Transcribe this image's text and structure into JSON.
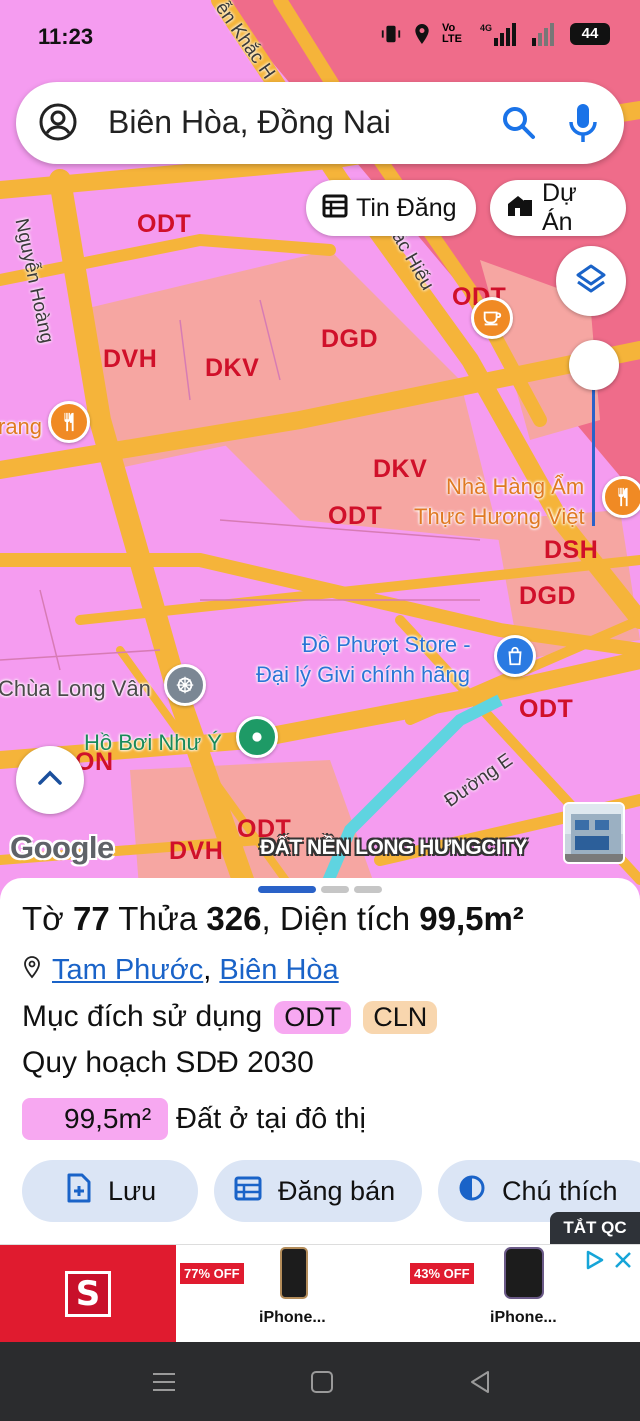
{
  "status_bar": {
    "time": "11:23",
    "battery": "44",
    "volte": "Vo LTE",
    "network": "4G"
  },
  "search": {
    "query": "Biên Hòa, Đồng Nai"
  },
  "chips": [
    {
      "label": "Tin Đăng",
      "icon": "calendar-icon"
    },
    {
      "label": "Dự Án",
      "icon": "building-icon"
    }
  ],
  "map": {
    "zones": [
      "ODT",
      "DVH",
      "DKV",
      "DGD",
      "ODT",
      "DKV",
      "ODT",
      "DSH",
      "DGD",
      "ODT",
      "ON",
      "DVH",
      "ODT"
    ],
    "streets": [
      "Nguyễn Hoàng",
      "ễn Khắc H",
      "ắc Hiếu",
      "Đường E",
      "rang"
    ],
    "pois": [
      {
        "label": "Nhà Hàng Ẩm\nThực Hương Việt",
        "line1": "Nhà Hàng Ẩm",
        "line2": "Thực Hương Việt",
        "icon": "restaurant-icon"
      },
      {
        "line1": "Đồ Phượt Store -",
        "line2": "Đại lý Givi chính hãng",
        "icon": "shopping-bag-icon"
      },
      {
        "label": "Chùa Long Vân",
        "icon": "temple-icon"
      },
      {
        "label": "Hồ Bơi Như Ý",
        "icon": "place-icon"
      }
    ],
    "google_logo": "Google",
    "banner": "ĐẤT NỀN LONG HƯNGCITY",
    "colors": {
      "residential": "#f59cf0",
      "public": "#f5a3a3",
      "road": "#f5b43a",
      "background": "#ef6c8a"
    }
  },
  "parcel": {
    "to_label": "Tờ",
    "to_value": "77",
    "thua_label": "Thửa",
    "thua_value": "326",
    "area_label": "Diện tích",
    "area_value": "99,5m²",
    "ward": "Tam Phước",
    "city": "Biên Hòa",
    "purpose_label": "Mục đích sử dụng",
    "purpose_tags": [
      "ODT",
      "CLN"
    ],
    "plan_label": "Quy hoạch SDĐ 2030",
    "plan_area": "99,5m²",
    "plan_type": "Đất ở tại đô thị"
  },
  "actions": [
    {
      "label": "Lưu",
      "icon": "add-note-icon"
    },
    {
      "label": "Đăng bán",
      "icon": "calendar-icon"
    },
    {
      "label": "Chú thích",
      "icon": "contrast-icon"
    }
  ],
  "ad": {
    "tag": "TẮT QC",
    "logo": "S",
    "items": [
      {
        "discount": "77% OFF",
        "name": "iPhone..."
      },
      {
        "discount": "43% OFF",
        "name": "iPhone..."
      }
    ]
  }
}
